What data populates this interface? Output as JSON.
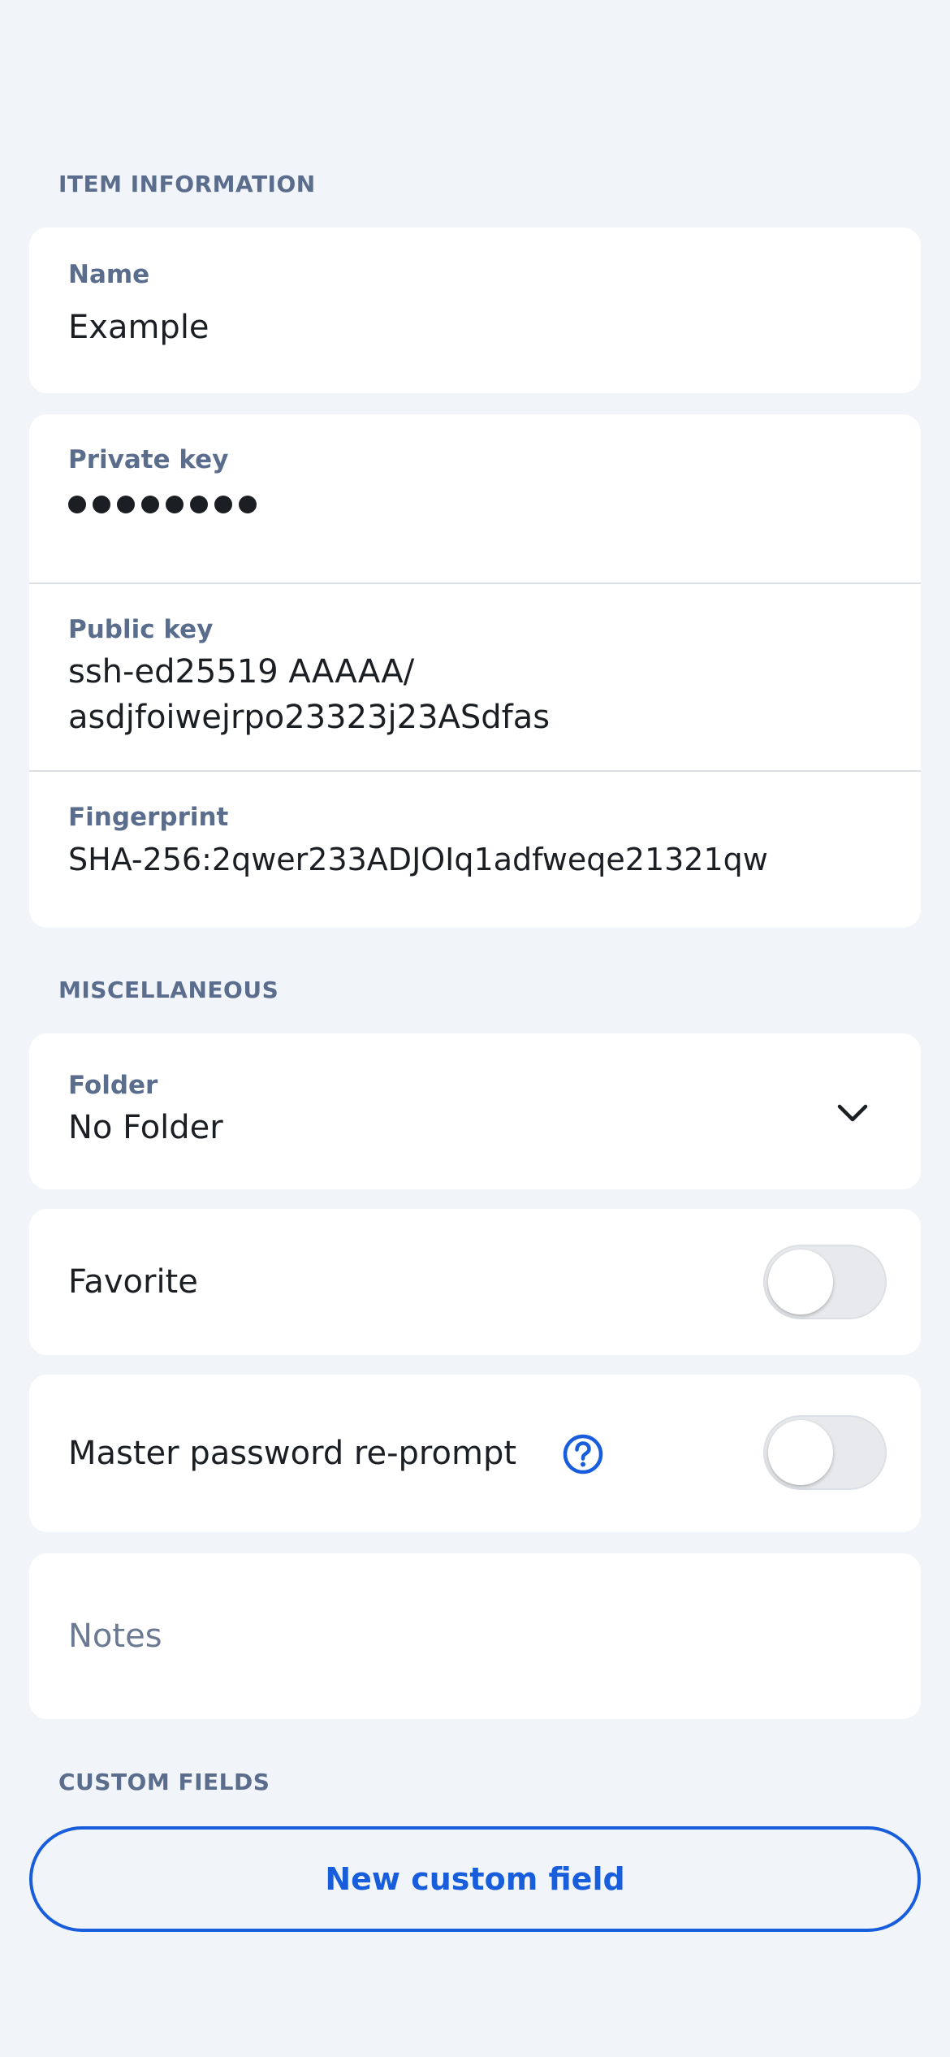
{
  "sections": {
    "item_information": "ITEM INFORMATION",
    "miscellaneous": "MISCELLANEOUS",
    "custom_fields": "CUSTOM FIELDS"
  },
  "name_field": {
    "label": "Name",
    "value": "Example"
  },
  "ssh": {
    "private_key": {
      "label": "Private key",
      "masked_char_count": 8
    },
    "public_key": {
      "label": "Public key",
      "value": "ssh-ed25519 AAAAA/\nasdjfoiwejrpo23323j23ASdfas"
    },
    "fingerprint": {
      "label": "Fingerprint",
      "value": "SHA-256:2qwer233ADJOIq1adfweqe21321qw"
    }
  },
  "folder": {
    "label": "Folder",
    "value": "No Folder",
    "icon": "chevron-down-icon"
  },
  "favorite": {
    "label": "Favorite",
    "enabled": false
  },
  "reprompt": {
    "label": "Master password re-prompt",
    "enabled": false,
    "help_icon": "question-circle-icon"
  },
  "notes": {
    "placeholder": "Notes"
  },
  "custom_fields": {
    "button_label": "New custom field"
  },
  "colors": {
    "accent": "#175ddc",
    "label": "#5a6d8c",
    "background": "#f1f4f8"
  }
}
